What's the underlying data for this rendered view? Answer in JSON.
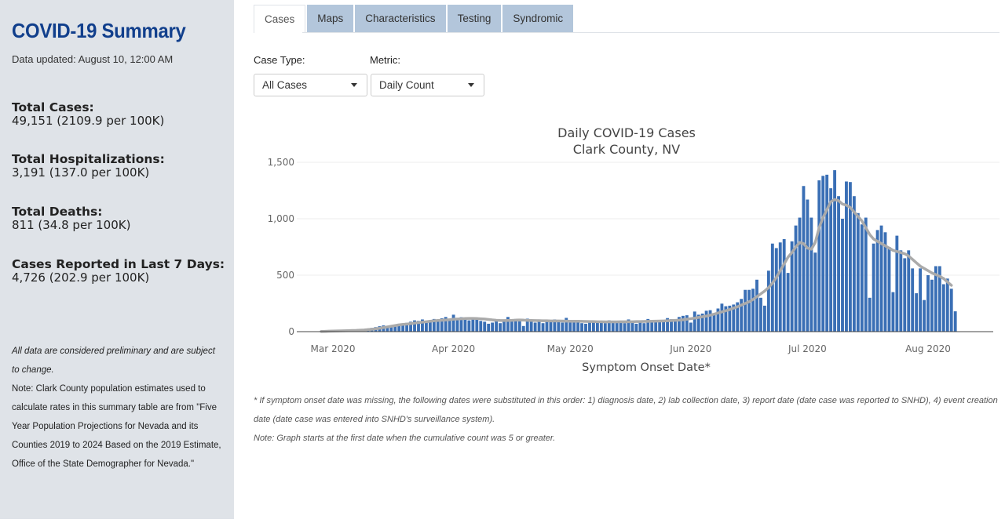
{
  "sidebar": {
    "title": "COVID-19 Summary",
    "updated": "Data updated: August 10, 12:00 AM",
    "stats": [
      {
        "label": "Total Cases:",
        "value": "49,151 (2109.9 per 100K)"
      },
      {
        "label": "Total Hospitalizations:",
        "value": "3,191 (137.0 per 100K)"
      },
      {
        "label": "Total Deaths:",
        "value": "811 (34.8 per 100K)"
      },
      {
        "label": "Cases Reported in Last 7 Days:",
        "value": "4,726 (202.9 per 100K)"
      }
    ],
    "note_prelim": "All data are considered preliminary and are subject to change.",
    "note_pop": "Note: Clark County population estimates used to calculate rates in this summary table are from \"Five Year Population Projections for Nevada and its Counties 2019 to 2024 Based on the 2019 Estimate, Office of the State Demographer for Nevada.\""
  },
  "tabs": [
    "Cases",
    "Maps",
    "Characteristics",
    "Testing",
    "Syndromic"
  ],
  "controls": {
    "case_type_label": "Case Type:",
    "case_type_value": "All Cases",
    "metric_label": "Metric:",
    "metric_value": "Daily Count"
  },
  "chart_data": {
    "type": "bar",
    "title": "Daily COVID-19 Cases",
    "subtitle": "Clark County, NV",
    "xlabel": "Symptom Onset Date*",
    "ylabel": "",
    "ylim": [
      0,
      1500
    ],
    "yticks": [
      0,
      500,
      1000,
      1500
    ],
    "ytick_labels": [
      "0",
      "500",
      "1,000",
      "1,500"
    ],
    "xtick_labels": [
      "Mar 2020",
      "Apr 2020",
      "May 2020",
      "Jun 2020",
      "Jul 2020",
      "Aug 2020"
    ],
    "xtick_dates": [
      "2020-03-01",
      "2020-04-01",
      "2020-05-01",
      "2020-06-01",
      "2020-07-01",
      "2020-08-01"
    ],
    "bar_color": "#3a6fb5",
    "line_color": "#aaaaaa",
    "start_date": "2020-02-23",
    "bar_series": {
      "name": "Daily Count",
      "values": [
        1,
        1,
        2,
        3,
        5,
        6,
        7,
        8,
        9,
        10,
        11,
        12,
        13,
        15,
        18,
        22,
        27,
        33,
        40,
        48,
        55,
        50,
        52,
        62,
        70,
        65,
        78,
        88,
        100,
        95,
        108,
        90,
        102,
        112,
        98,
        118,
        130,
        105,
        150,
        115,
        128,
        120,
        100,
        112,
        108,
        95,
        88,
        70,
        80,
        108,
        75,
        90,
        130,
        105,
        112,
        90,
        50,
        115,
        100,
        80,
        108,
        75,
        90,
        95,
        108,
        100,
        80,
        122,
        85,
        92,
        90,
        75,
        70,
        85,
        95,
        80,
        92,
        75,
        100,
        88,
        90,
        95,
        75,
        108,
        80,
        70,
        95,
        75,
        112,
        100,
        95,
        102,
        85,
        120,
        110,
        95,
        130,
        140,
        145,
        80,
        178,
        150,
        160,
        185,
        190,
        150,
        205,
        248,
        225,
        230,
        240,
        260,
        290,
        370,
        370,
        380,
        460,
        300,
        230,
        540,
        780,
        740,
        790,
        820,
        520,
        800,
        940,
        1010,
        1290,
        1170,
        1010,
        700,
        1340,
        1380,
        1390,
        1270,
        1430,
        1200,
        1000,
        1330,
        1325,
        1200,
        1050,
        950,
        1010,
        300,
        780,
        900,
        940,
        880,
        750,
        350,
        850,
        720,
        650,
        720,
        560,
        340,
        560,
        280,
        500,
        460,
        580,
        580,
        420,
        470,
        380,
        180
      ]
    },
    "line_series": {
      "name": "7-Day Average",
      "values": [
        null,
        null,
        null,
        null,
        2,
        3,
        4,
        5,
        6,
        7,
        8,
        9,
        10,
        11,
        13,
        15,
        18,
        21,
        25,
        30,
        36,
        42,
        48,
        54,
        60,
        64,
        67,
        71,
        76,
        80,
        84,
        88,
        92,
        96,
        99,
        101,
        103,
        106,
        110,
        112,
        114,
        116,
        117,
        117,
        116,
        114,
        112,
        108,
        104,
        101,
        99,
        98,
        99,
        100,
        102,
        103,
        102,
        100,
        99,
        98,
        97,
        96,
        96,
        95,
        95,
        95,
        94,
        93,
        92,
        92,
        92,
        91,
        90,
        89,
        89,
        88,
        88,
        87,
        87,
        87,
        87,
        88,
        88,
        88,
        88,
        89,
        89,
        90,
        91,
        92,
        93,
        94,
        95,
        96,
        98,
        100,
        102,
        105,
        110,
        115,
        120,
        126,
        132,
        138,
        146,
        155,
        165,
        175,
        185,
        195,
        208,
        220,
        235,
        250,
        265,
        285,
        310,
        335,
        360,
        390,
        430,
        480,
        540,
        600,
        660,
        700,
        750,
        790,
        780,
        740,
        730,
        790,
        920,
        1010,
        1080,
        1150,
        1170,
        1160,
        1130,
        1120,
        1100,
        1060,
        1020,
        980,
        920,
        860,
        820,
        800,
        780,
        760,
        740,
        720,
        710,
        700,
        690,
        670,
        640,
        610,
        580,
        560,
        540,
        520,
        505,
        490,
        470,
        440,
        410
      ]
    }
  },
  "footnotes": [
    "* If symptom onset date was missing, the following dates were substituted in this order: 1) diagnosis date, 2) lab collection date, 3) report date (date case was reported to SNHD), 4) event creation date (date case was entered into SNHD's surveillance system).",
    "Note: Graph starts at the first date when the cumulative count was 5 or greater."
  ]
}
